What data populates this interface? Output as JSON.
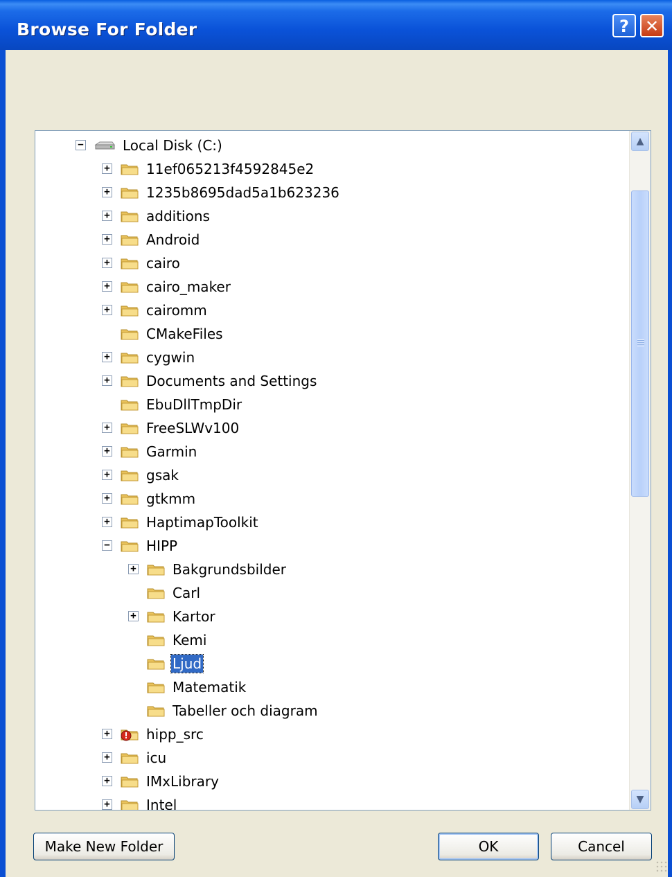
{
  "window": {
    "title": "Browse For Folder",
    "help_label": "?",
    "close_label": "✕"
  },
  "tree": {
    "root": {
      "label": "Local Disk (C:)",
      "icon": "drive-icon",
      "expanded": true
    },
    "items": [
      {
        "label": "11ef065213f4592845e2",
        "level": 1,
        "expander": "+"
      },
      {
        "label": "1235b8695dad5a1b623236",
        "level": 1,
        "expander": "+"
      },
      {
        "label": "additions",
        "level": 1,
        "expander": "+"
      },
      {
        "label": "Android",
        "level": 1,
        "expander": "+"
      },
      {
        "label": "cairo",
        "level": 1,
        "expander": "+"
      },
      {
        "label": "cairo_maker",
        "level": 1,
        "expander": "+"
      },
      {
        "label": "cairomm",
        "level": 1,
        "expander": "+"
      },
      {
        "label": "CMakeFiles",
        "level": 1,
        "expander": ""
      },
      {
        "label": "cygwin",
        "level": 1,
        "expander": "+"
      },
      {
        "label": "Documents and Settings",
        "level": 1,
        "expander": "+"
      },
      {
        "label": "EbuDllTmpDir",
        "level": 1,
        "expander": ""
      },
      {
        "label": "FreeSLWv100",
        "level": 1,
        "expander": "+"
      },
      {
        "label": "Garmin",
        "level": 1,
        "expander": "+"
      },
      {
        "label": "gsak",
        "level": 1,
        "expander": "+"
      },
      {
        "label": "gtkmm",
        "level": 1,
        "expander": "+"
      },
      {
        "label": "HaptimapToolkit",
        "level": 1,
        "expander": "+"
      },
      {
        "label": "HIPP",
        "level": 1,
        "expander": "−"
      },
      {
        "label": "Bakgrundsbilder",
        "level": 2,
        "expander": "+"
      },
      {
        "label": "Carl",
        "level": 2,
        "expander": ""
      },
      {
        "label": "Kartor",
        "level": 2,
        "expander": "+"
      },
      {
        "label": "Kemi",
        "level": 2,
        "expander": ""
      },
      {
        "label": "Ljud",
        "level": 2,
        "expander": "",
        "selected": true
      },
      {
        "label": "Matematik",
        "level": 2,
        "expander": ""
      },
      {
        "label": "Tabeller och diagram",
        "level": 2,
        "expander": ""
      },
      {
        "label": "hipp_src",
        "level": 1,
        "expander": "+",
        "warning": true
      },
      {
        "label": "icu",
        "level": 1,
        "expander": "+"
      },
      {
        "label": "IMxLibrary",
        "level": 1,
        "expander": "+"
      },
      {
        "label": "Intel",
        "level": 1,
        "expander": "+"
      }
    ]
  },
  "buttons": {
    "make_new_folder": "Make New Folder",
    "ok": "OK",
    "cancel": "Cancel"
  },
  "colors": {
    "title_bar": "#0a52d8",
    "selection": "#316ac5",
    "folder": "#f5d77a",
    "dialog_bg": "#ece9d8"
  }
}
